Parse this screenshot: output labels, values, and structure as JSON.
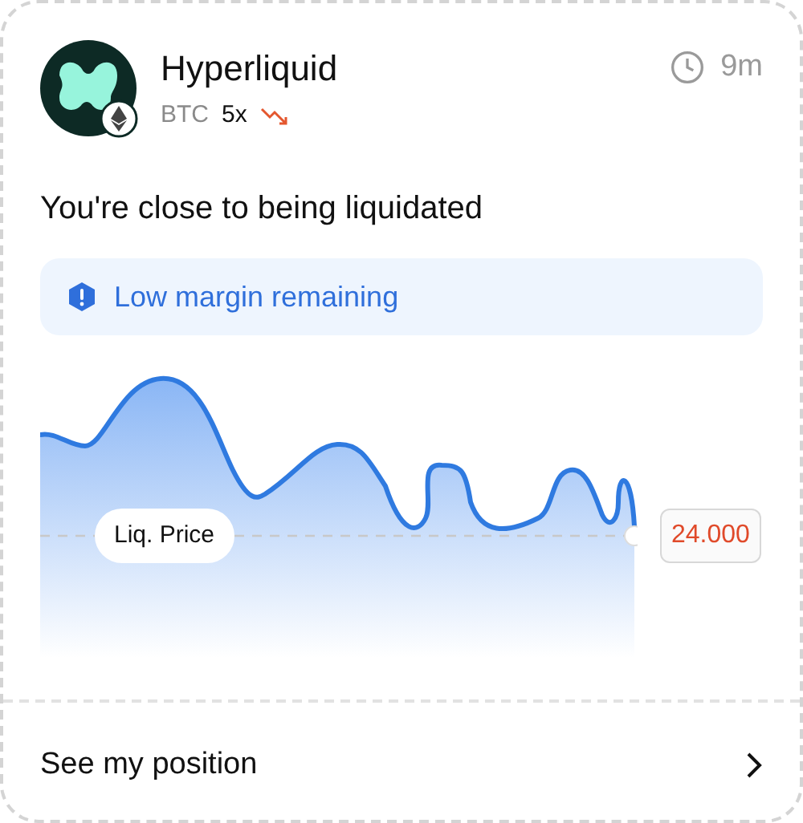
{
  "header": {
    "title": "Hyperliquid",
    "asset": "BTC",
    "leverage": "5x",
    "time": "9m"
  },
  "message": "You're close to being liquidated",
  "alert": {
    "text": "Low margin remaining"
  },
  "chart": {
    "liq_label": "Liq. Price",
    "liq_price": "24.000"
  },
  "footer": {
    "link": "See my position"
  }
}
